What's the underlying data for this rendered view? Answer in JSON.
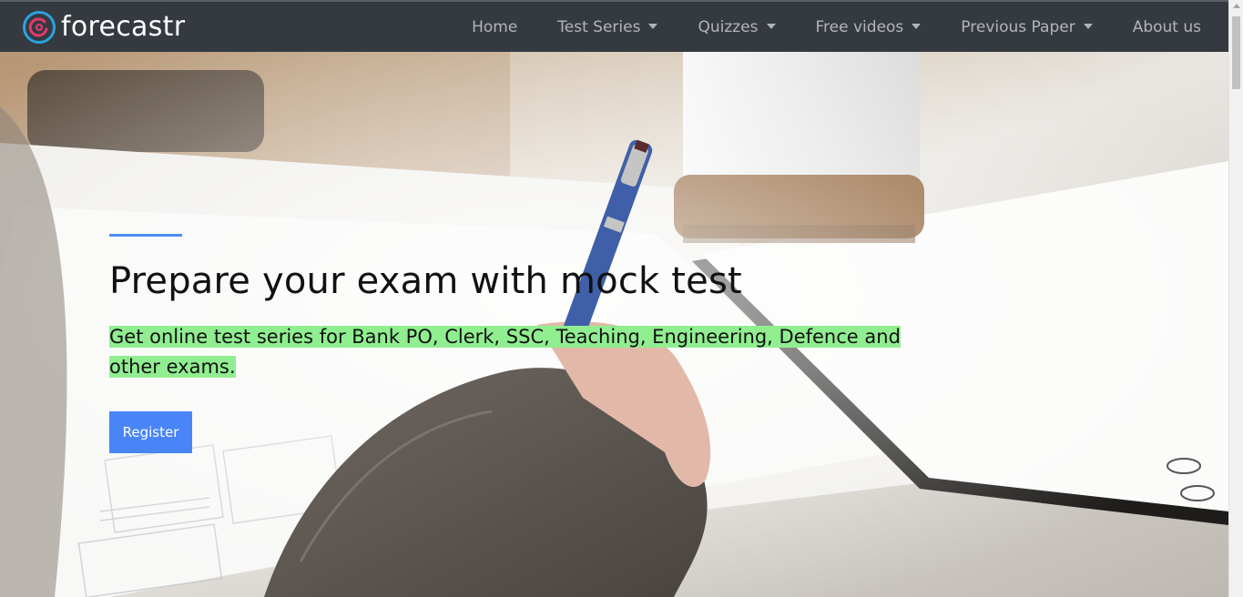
{
  "brand": {
    "name": "forecastr",
    "accent_outer": "#2aa2e0",
    "accent_inner": "#e03a6b"
  },
  "nav": {
    "items": [
      {
        "label": "Home",
        "dropdown": false
      },
      {
        "label": "Test Series",
        "dropdown": true
      },
      {
        "label": "Quizzes",
        "dropdown": true
      },
      {
        "label": "Free videos",
        "dropdown": true
      },
      {
        "label": "Previous Paper",
        "dropdown": true
      },
      {
        "label": "About us",
        "dropdown": false
      }
    ]
  },
  "hero": {
    "title": "Prepare your exam with mock test",
    "subtitle": "Get online test series for Bank PO, Clerk, SSC, Teaching, Engineering, Defence and other exams.",
    "register_label": "Register",
    "accent_color": "#4a8cf7",
    "highlight_color": "#90ee90"
  }
}
